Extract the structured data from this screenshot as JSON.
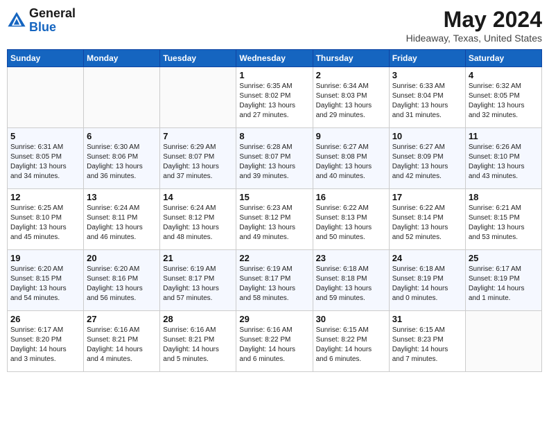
{
  "header": {
    "logo_general": "General",
    "logo_blue": "Blue",
    "month": "May 2024",
    "location": "Hideaway, Texas, United States"
  },
  "days_of_week": [
    "Sunday",
    "Monday",
    "Tuesday",
    "Wednesday",
    "Thursday",
    "Friday",
    "Saturday"
  ],
  "weeks": [
    [
      {
        "day": "",
        "info": ""
      },
      {
        "day": "",
        "info": ""
      },
      {
        "day": "",
        "info": ""
      },
      {
        "day": "1",
        "info": "Sunrise: 6:35 AM\nSunset: 8:02 PM\nDaylight: 13 hours\nand 27 minutes."
      },
      {
        "day": "2",
        "info": "Sunrise: 6:34 AM\nSunset: 8:03 PM\nDaylight: 13 hours\nand 29 minutes."
      },
      {
        "day": "3",
        "info": "Sunrise: 6:33 AM\nSunset: 8:04 PM\nDaylight: 13 hours\nand 31 minutes."
      },
      {
        "day": "4",
        "info": "Sunrise: 6:32 AM\nSunset: 8:05 PM\nDaylight: 13 hours\nand 32 minutes."
      }
    ],
    [
      {
        "day": "5",
        "info": "Sunrise: 6:31 AM\nSunset: 8:05 PM\nDaylight: 13 hours\nand 34 minutes."
      },
      {
        "day": "6",
        "info": "Sunrise: 6:30 AM\nSunset: 8:06 PM\nDaylight: 13 hours\nand 36 minutes."
      },
      {
        "day": "7",
        "info": "Sunrise: 6:29 AM\nSunset: 8:07 PM\nDaylight: 13 hours\nand 37 minutes."
      },
      {
        "day": "8",
        "info": "Sunrise: 6:28 AM\nSunset: 8:07 PM\nDaylight: 13 hours\nand 39 minutes."
      },
      {
        "day": "9",
        "info": "Sunrise: 6:27 AM\nSunset: 8:08 PM\nDaylight: 13 hours\nand 40 minutes."
      },
      {
        "day": "10",
        "info": "Sunrise: 6:27 AM\nSunset: 8:09 PM\nDaylight: 13 hours\nand 42 minutes."
      },
      {
        "day": "11",
        "info": "Sunrise: 6:26 AM\nSunset: 8:10 PM\nDaylight: 13 hours\nand 43 minutes."
      }
    ],
    [
      {
        "day": "12",
        "info": "Sunrise: 6:25 AM\nSunset: 8:10 PM\nDaylight: 13 hours\nand 45 minutes."
      },
      {
        "day": "13",
        "info": "Sunrise: 6:24 AM\nSunset: 8:11 PM\nDaylight: 13 hours\nand 46 minutes."
      },
      {
        "day": "14",
        "info": "Sunrise: 6:24 AM\nSunset: 8:12 PM\nDaylight: 13 hours\nand 48 minutes."
      },
      {
        "day": "15",
        "info": "Sunrise: 6:23 AM\nSunset: 8:12 PM\nDaylight: 13 hours\nand 49 minutes."
      },
      {
        "day": "16",
        "info": "Sunrise: 6:22 AM\nSunset: 8:13 PM\nDaylight: 13 hours\nand 50 minutes."
      },
      {
        "day": "17",
        "info": "Sunrise: 6:22 AM\nSunset: 8:14 PM\nDaylight: 13 hours\nand 52 minutes."
      },
      {
        "day": "18",
        "info": "Sunrise: 6:21 AM\nSunset: 8:15 PM\nDaylight: 13 hours\nand 53 minutes."
      }
    ],
    [
      {
        "day": "19",
        "info": "Sunrise: 6:20 AM\nSunset: 8:15 PM\nDaylight: 13 hours\nand 54 minutes."
      },
      {
        "day": "20",
        "info": "Sunrise: 6:20 AM\nSunset: 8:16 PM\nDaylight: 13 hours\nand 56 minutes."
      },
      {
        "day": "21",
        "info": "Sunrise: 6:19 AM\nSunset: 8:17 PM\nDaylight: 13 hours\nand 57 minutes."
      },
      {
        "day": "22",
        "info": "Sunrise: 6:19 AM\nSunset: 8:17 PM\nDaylight: 13 hours\nand 58 minutes."
      },
      {
        "day": "23",
        "info": "Sunrise: 6:18 AM\nSunset: 8:18 PM\nDaylight: 13 hours\nand 59 minutes."
      },
      {
        "day": "24",
        "info": "Sunrise: 6:18 AM\nSunset: 8:19 PM\nDaylight: 14 hours\nand 0 minutes."
      },
      {
        "day": "25",
        "info": "Sunrise: 6:17 AM\nSunset: 8:19 PM\nDaylight: 14 hours\nand 1 minute."
      }
    ],
    [
      {
        "day": "26",
        "info": "Sunrise: 6:17 AM\nSunset: 8:20 PM\nDaylight: 14 hours\nand 3 minutes."
      },
      {
        "day": "27",
        "info": "Sunrise: 6:16 AM\nSunset: 8:21 PM\nDaylight: 14 hours\nand 4 minutes."
      },
      {
        "day": "28",
        "info": "Sunrise: 6:16 AM\nSunset: 8:21 PM\nDaylight: 14 hours\nand 5 minutes."
      },
      {
        "day": "29",
        "info": "Sunrise: 6:16 AM\nSunset: 8:22 PM\nDaylight: 14 hours\nand 6 minutes."
      },
      {
        "day": "30",
        "info": "Sunrise: 6:15 AM\nSunset: 8:22 PM\nDaylight: 14 hours\nand 6 minutes."
      },
      {
        "day": "31",
        "info": "Sunrise: 6:15 AM\nSunset: 8:23 PM\nDaylight: 14 hours\nand 7 minutes."
      },
      {
        "day": "",
        "info": ""
      }
    ]
  ]
}
